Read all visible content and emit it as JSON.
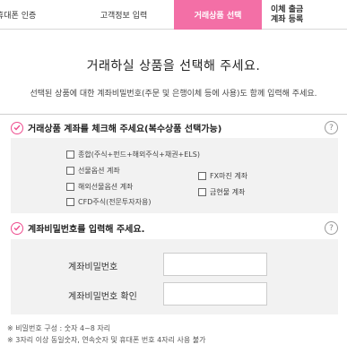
{
  "tabs": [
    {
      "label": "휴대폰 인증"
    },
    {
      "label": "고객정보 입력"
    },
    {
      "label": "거래상품 선택"
    },
    {
      "label_line1": "이체 출금",
      "label_line2": "계좌 등록"
    }
  ],
  "heading": "거래하실 상품을 선택해 주세요.",
  "description": "선택된 상품에 대한 계좌비밀번호(주문 및 은행이체 등에 사용)도 함께 입력해 주세요.",
  "section1": {
    "title": "거래상품 계좌를 체크해 주세요(복수상품 선택가능)",
    "help": "?",
    "options": [
      {
        "label": "종합(주식+펀드+해외주식+채권+ELS)",
        "checked": false
      },
      {
        "label": "선물옵션 계좌",
        "checked": false
      },
      {
        "label": "해외선물옵션 계좌",
        "checked": false
      },
      {
        "label": "CFD주식(전문투자자용)",
        "checked": false
      },
      {
        "label": "FX마진 계좌",
        "checked": false
      },
      {
        "label": "금현물 계좌",
        "checked": false
      }
    ]
  },
  "section2": {
    "title": "계좌비밀번호를 입력해 주세요.",
    "help": "?",
    "fields": [
      {
        "label": "계좌비밀번호",
        "value": ""
      },
      {
        "label": "계좌비밀번호 확인",
        "value": ""
      }
    ]
  },
  "notes": [
    "※ 비밀번호 구성 : 숫자 4~8 자리",
    "※ 3자리 이상 동일숫자, 연속숫자 및 휴대폰 번호 4자리 사용 불가"
  ],
  "colors": {
    "accent": "#f36fa6",
    "check": "#ee4d8f"
  }
}
